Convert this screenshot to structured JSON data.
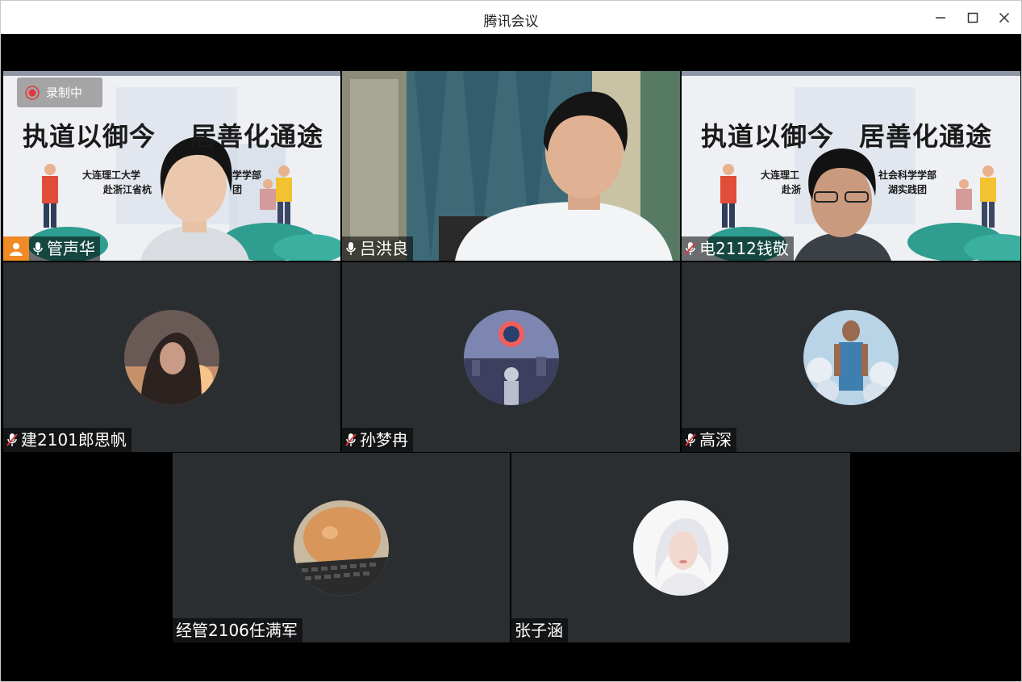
{
  "window": {
    "title": "腾讯会议"
  },
  "recording": {
    "label": "录制中"
  },
  "banner": {
    "title_left": "执道以御今",
    "title_right": "居善化通途",
    "line1_left": "大连理工大学",
    "line1_right": "学学部",
    "line2_left": "赴浙江省杭",
    "line2_right": "团",
    "line1_b_left": "大连理工",
    "line1_b_right": "社会科学学部",
    "line2_b_left": "赴浙",
    "line2_b_right": "湖实践团"
  },
  "participants": [
    {
      "name": "管声华",
      "mic": "on",
      "host": true,
      "video": true
    },
    {
      "name": "吕洪良",
      "mic": "on",
      "host": false,
      "video": true,
      "speaking": true
    },
    {
      "name": "电2112钱敬",
      "mic": "muted",
      "host": false,
      "video": true
    },
    {
      "name": "建2101郎思帆",
      "mic": "muted",
      "host": false,
      "video": false
    },
    {
      "name": "孙梦冉",
      "mic": "muted",
      "host": false,
      "video": false
    },
    {
      "name": "高深",
      "mic": "muted",
      "host": false,
      "video": false
    },
    {
      "name": "经管2106任满军",
      "mic": "none",
      "host": false,
      "video": false
    },
    {
      "name": "张子涵",
      "mic": "none",
      "host": false,
      "video": false
    }
  ],
  "colors": {
    "tile_bg": "#2b2e31",
    "active_border": "#17b35f",
    "host_badge": "#f08a24",
    "muted_red": "#e0383e"
  },
  "icons": {
    "minimize": "minimize-icon",
    "maximize": "maximize-icon",
    "close": "close-icon",
    "mic_on": "microphone-icon",
    "mic_muted": "microphone-muted-icon",
    "host": "host-person-icon",
    "record": "record-dot-icon"
  }
}
